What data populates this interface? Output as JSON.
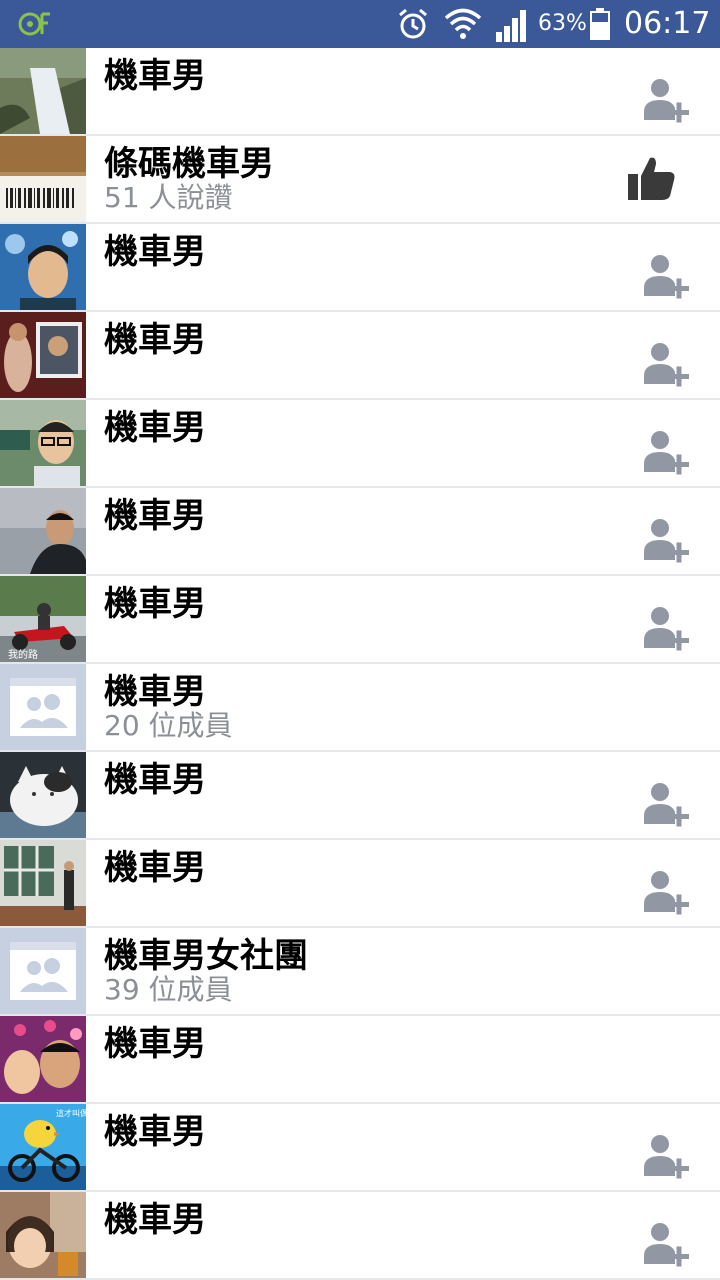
{
  "status_bar": {
    "battery_percent": "63%",
    "time": "06:17"
  },
  "results": [
    {
      "name": "機車男",
      "subtitle": "",
      "thumb": "waterfall-photo",
      "action": "add-friend"
    },
    {
      "name": "條碼機車男",
      "subtitle": "51 人說讚",
      "thumb": "barcode-photo",
      "action": "like"
    },
    {
      "name": "機車男",
      "subtitle": "",
      "thumb": "portrait-blue",
      "action": "add-friend"
    },
    {
      "name": "機車男",
      "subtitle": "",
      "thumb": "collage-photo",
      "action": "add-friend"
    },
    {
      "name": "機車男",
      "subtitle": "",
      "thumb": "glasses-portrait",
      "action": "add-friend"
    },
    {
      "name": "機車男",
      "subtitle": "",
      "thumb": "foggy-portrait",
      "action": "add-friend"
    },
    {
      "name": "機車男",
      "subtitle": "",
      "thumb": "scooter-photo",
      "action": "add-friend"
    },
    {
      "name": "機車男",
      "subtitle": "20 位成員",
      "thumb": "group-placeholder",
      "action": "none"
    },
    {
      "name": "機車男",
      "subtitle": "",
      "thumb": "cat-photo",
      "action": "add-friend"
    },
    {
      "name": "機車男",
      "subtitle": "",
      "thumb": "window-photo",
      "action": "add-friend"
    },
    {
      "name": "機車男女社團",
      "subtitle": "39 位成員",
      "thumb": "group-placeholder",
      "action": "none"
    },
    {
      "name": "機車男",
      "subtitle": "",
      "thumb": "couple-photo",
      "action": "none"
    },
    {
      "name": "機車男",
      "subtitle": "",
      "thumb": "chick-bike-photo",
      "action": "add-friend"
    },
    {
      "name": "機車男",
      "subtitle": "",
      "thumb": "child-photo",
      "action": "add-friend"
    }
  ],
  "colors": {
    "statusbar": "#3b5998",
    "subtitle": "#8b8f96",
    "add_icon": "#9197a3",
    "like_icon": "#3a3a3a"
  }
}
